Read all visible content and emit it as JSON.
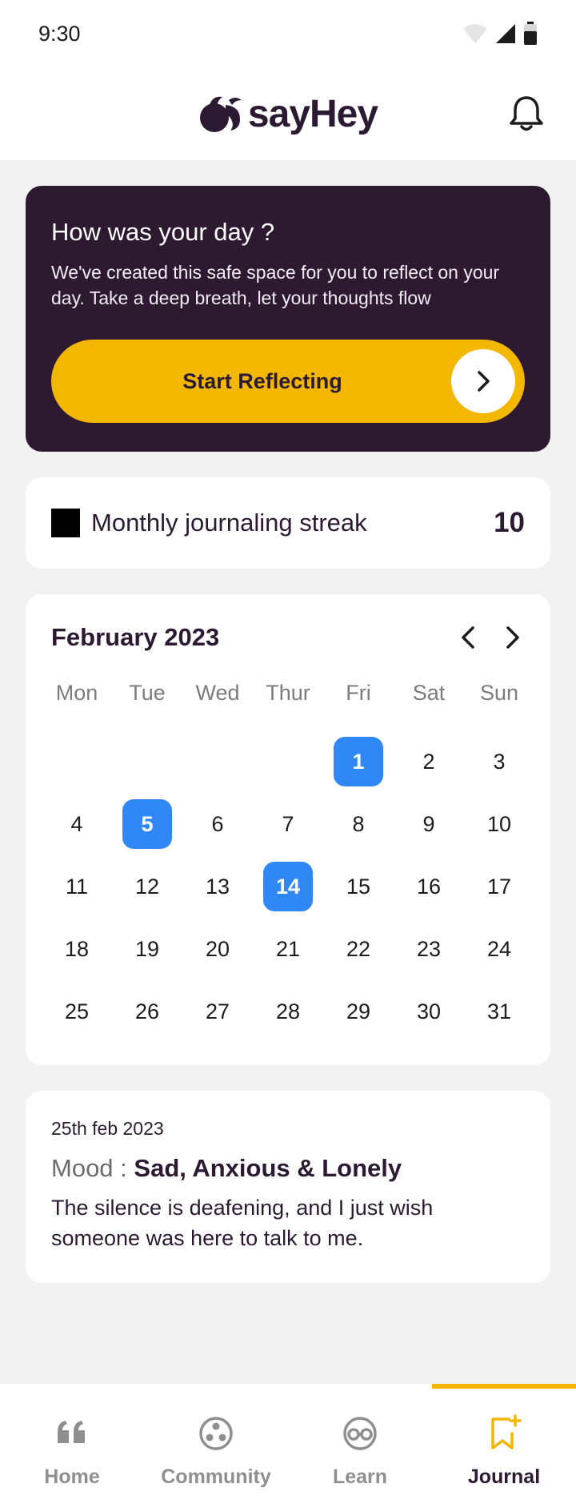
{
  "status": {
    "time": "9:30"
  },
  "header": {
    "brand": "sayHey"
  },
  "hero": {
    "title": "How was your day ?",
    "subtitle": "We've created this safe space for you to reflect on your day. Take a deep breath, let your thoughts flow",
    "cta_label": "Start Reflecting"
  },
  "streak": {
    "label": "Monthly journaling streak",
    "count": "10"
  },
  "calendar": {
    "title": "February 2023",
    "weekdays": [
      "Mon",
      "Tue",
      "Wed",
      "Thur",
      "Fri",
      "Sat",
      "Sun"
    ],
    "leading_blanks": 4,
    "days": [
      "1",
      "2",
      "3",
      "4",
      "5",
      "6",
      "7",
      "8",
      "9",
      "10",
      "11",
      "12",
      "13",
      "14",
      "15",
      "16",
      "17",
      "18",
      "19",
      "20",
      "21",
      "22",
      "23",
      "24",
      "25",
      "26",
      "27",
      "28",
      "29",
      "30",
      "31"
    ],
    "selected_days": [
      "1",
      "5",
      "14"
    ]
  },
  "entry": {
    "date": "25th feb 2023",
    "mood_label": "Mood :",
    "mood_value": "Sad, Anxious & Lonely",
    "text": "The silence is deafening, and I just wish someone was here to talk to me."
  },
  "nav": {
    "items": [
      {
        "label": "Home",
        "icon": "quote-icon"
      },
      {
        "label": "Community",
        "icon": "community-icon"
      },
      {
        "label": "Learn",
        "icon": "glasses-icon"
      },
      {
        "label": "Journal",
        "icon": "journal-bookmark-icon"
      }
    ],
    "active": "Journal"
  },
  "colors": {
    "brand": "#2d1a31",
    "accent": "#f3b700",
    "selected": "#2f88f5"
  }
}
